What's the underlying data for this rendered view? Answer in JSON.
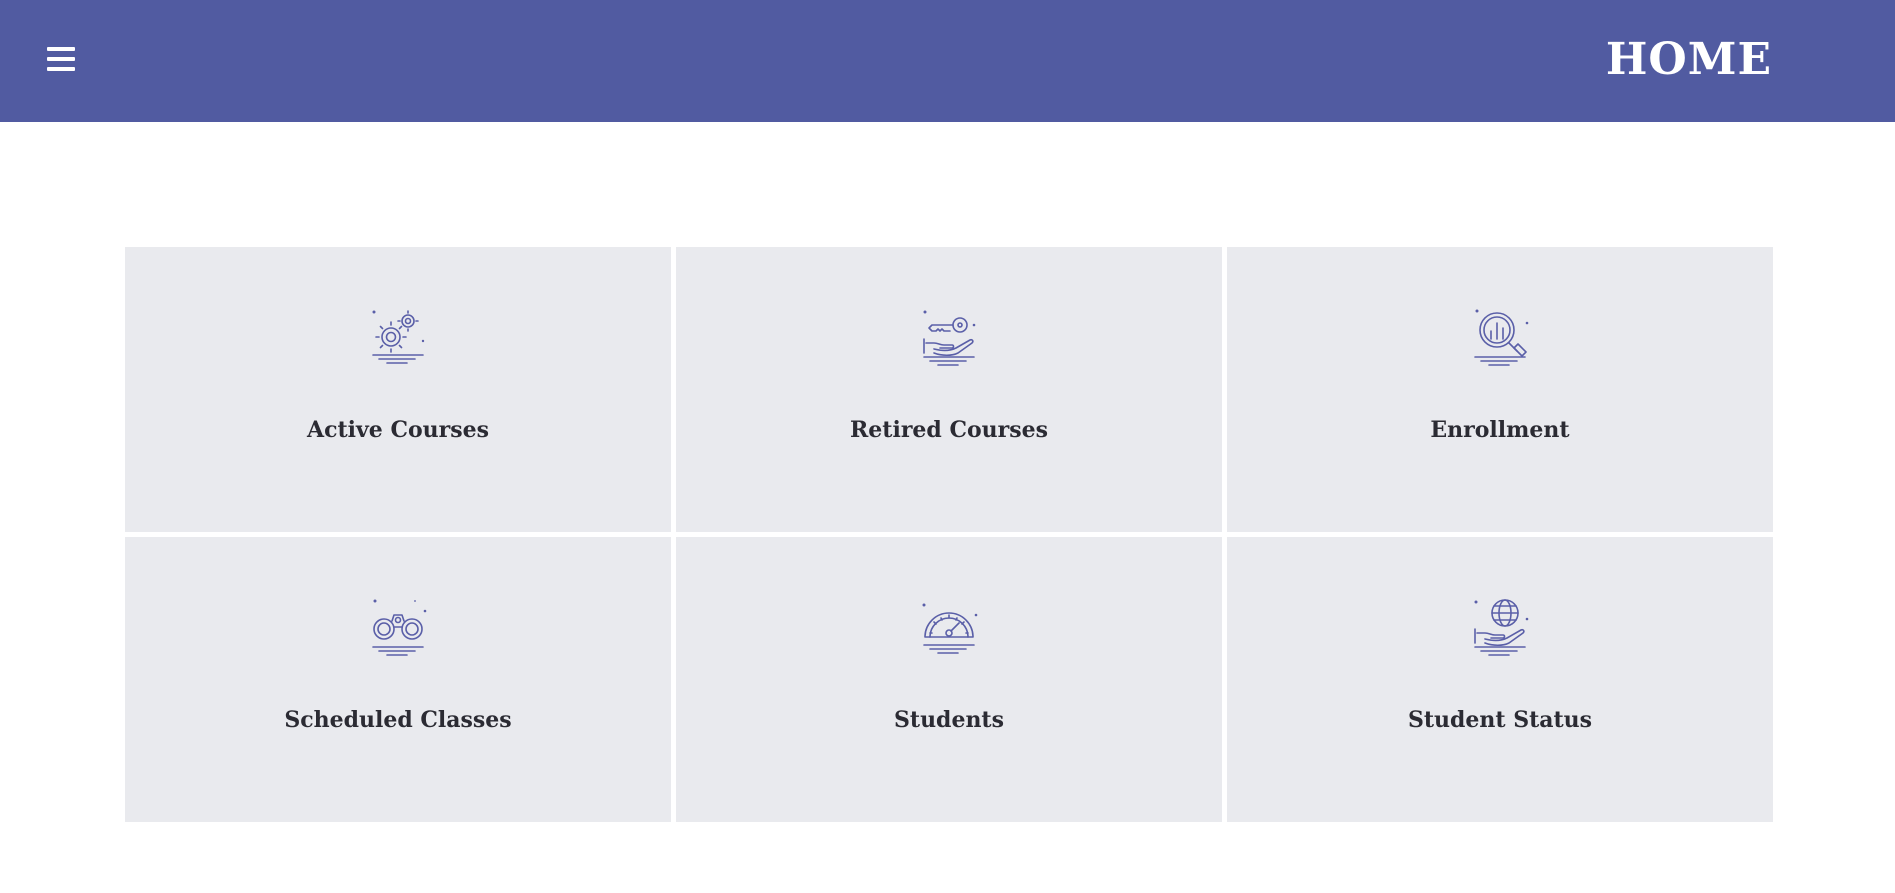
{
  "header": {
    "title": "HOME",
    "menu_icon": "hamburger-menu-icon",
    "background_color": "#515ba1"
  },
  "tiles": [
    {
      "label": "Active Courses",
      "icon": "gears-icon"
    },
    {
      "label": "Retired Courses",
      "icon": "hand-key-icon"
    },
    {
      "label": "Enrollment",
      "icon": "magnifier-chart-icon"
    },
    {
      "label": "Scheduled Classes",
      "icon": "binoculars-icon"
    },
    {
      "label": "Students",
      "icon": "speedometer-icon"
    },
    {
      "label": "Student Status",
      "icon": "hand-globe-icon"
    }
  ],
  "colors": {
    "tile_background": "#e9eaee",
    "icon_color": "#5a5fa8",
    "label_color": "#2b2b33"
  }
}
